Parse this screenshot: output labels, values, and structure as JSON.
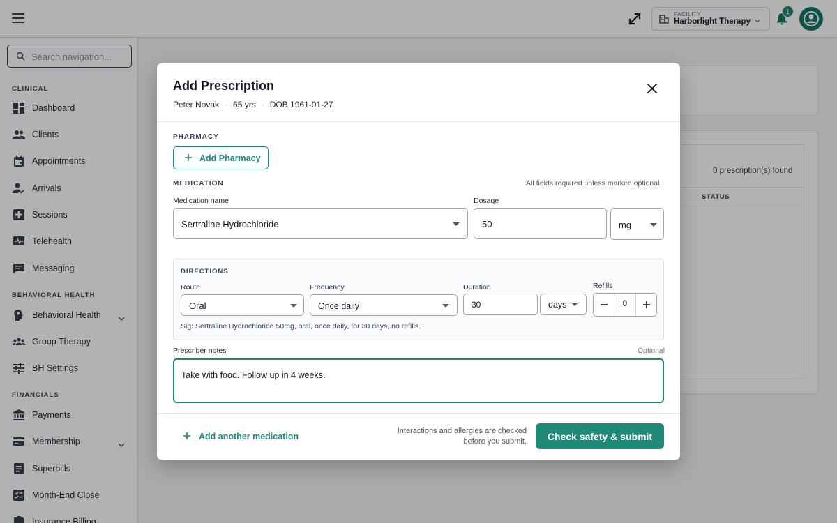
{
  "topbar": {
    "facility_label": "FACILITY",
    "facility_name": "Harborlight Therapy",
    "notification_count": "1"
  },
  "sidebar": {
    "search_placeholder": "Search navigation...",
    "sections": {
      "clinical": "CLINICAL",
      "behavioral": "BEHAVIORAL HEALTH",
      "financials": "FINANCIALS"
    },
    "items": {
      "dashboard": "Dashboard",
      "clients": "Clients",
      "appointments": "Appointments",
      "arrivals": "Arrivals",
      "sessions": "Sessions",
      "telehealth": "Telehealth",
      "messaging": "Messaging",
      "behavioral_health": "Behavioral Health",
      "group_therapy": "Group Therapy",
      "bh_settings": "BH Settings",
      "payments": "Payments",
      "membership": "Membership",
      "superbills": "Superbills",
      "month_end_close": "Month-End Close",
      "insurance_billing": "Insurance Billing"
    }
  },
  "background": {
    "count": "0 prescription(s) found",
    "status_header": "STATUS"
  },
  "modal": {
    "title": "Add Prescription",
    "patient": {
      "name": "Peter Novak",
      "age": "65 yrs",
      "dob": "DOB 1961-01-27"
    },
    "pharmacy_label": "PHARMACY",
    "add_pharmacy": "Add Pharmacy",
    "medication_label": "MEDICATION",
    "required_hint": "All fields required unless marked optional",
    "med_name_label": "Medication name",
    "med_name_value": "Sertraline Hydrochloride",
    "dosage_label": "Dosage",
    "dosage_value": "50",
    "unit_value": "mg",
    "directions": {
      "label": "DIRECTIONS",
      "route_label": "Route",
      "route_value": "Oral",
      "frequency_label": "Frequency",
      "frequency_value": "Once daily",
      "duration_label": "Duration",
      "duration_value": "30",
      "duration_unit": "days",
      "refills_label": "Refills",
      "refills_value": "0",
      "sig": "Sig: Sertraline Hydrochloride 50mg, oral, once daily, for 30 days, no refills."
    },
    "notes_label": "Prescriber notes",
    "notes_optional": "Optional",
    "notes_value": "Take with food. Follow up in 4 weeks.",
    "add_medication": "Add another medication",
    "footer_hint_line1": "Interactions and allergies are checked",
    "footer_hint_line2": "before you submit.",
    "submit_label": "Check safety & submit"
  },
  "colors": {
    "accent": "#1f8a78",
    "avatar": "#14786a"
  }
}
